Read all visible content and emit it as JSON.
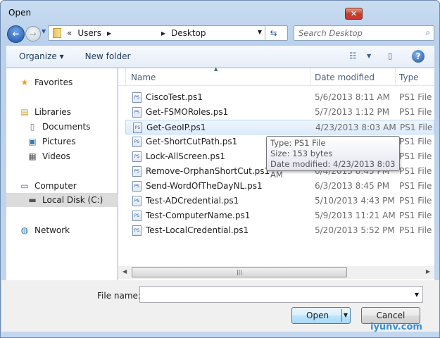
{
  "window": {
    "title": "Open",
    "close": "✕"
  },
  "address": {
    "path": [
      "«",
      "Users",
      "▸",
      "▸",
      "Desktop"
    ]
  },
  "search": {
    "placeholder": "Search Desktop"
  },
  "toolbar": {
    "organize": "Organize ▾",
    "new_folder": "New folder"
  },
  "nav": [
    {
      "label": "Favorites",
      "icon": "★"
    },
    {
      "label": "Libraries",
      "icon": "▤"
    },
    {
      "label": "Documents",
      "icon": "▯"
    },
    {
      "label": "Pictures",
      "icon": "▣"
    },
    {
      "label": "Videos",
      "icon": "▦"
    },
    {
      "label": "Computer",
      "icon": "▭"
    },
    {
      "label": "Local Disk (C:)",
      "icon": "▬"
    },
    {
      "label": "Network",
      "icon": "◍"
    }
  ],
  "columns": {
    "name": "Name",
    "date": "Date modified",
    "type": "Type"
  },
  "files": [
    {
      "name": "CiscoTest.ps1",
      "date": "5/6/2013 8:11 AM",
      "type": "PS1 File"
    },
    {
      "name": "Get-FSMORoles.ps1",
      "date": "5/7/2013 1:12 PM",
      "type": "PS1 File"
    },
    {
      "name": "Get-GeoIP.ps1",
      "date": "4/23/2013 8:03 AM",
      "type": "PS1 File"
    },
    {
      "name": "Get-ShortCutPath.ps1",
      "date": "",
      "type": "PS1 File"
    },
    {
      "name": "Lock-AllScreen.ps1",
      "date": "",
      "type": "PS1 File"
    },
    {
      "name": "Remove-OrphanShortCut.ps1",
      "date": "6/4/2013 8:45 PM",
      "type": "PS1 File"
    },
    {
      "name": "Send-WordOfTheDayNL.ps1",
      "date": "6/3/2013 8:45 PM",
      "type": "PS1 File"
    },
    {
      "name": "Test-ADCredential.ps1",
      "date": "5/10/2013 4:43 PM",
      "type": "PS1 File"
    },
    {
      "name": "Test-ComputerName.ps1",
      "date": "5/9/2013 11:21 AM",
      "type": "PS1 File"
    },
    {
      "name": "Test-LocalCredential.ps1",
      "date": "5/20/2013 5:52 PM",
      "type": "PS1 File"
    }
  ],
  "tooltip": {
    "type": "Type: PS1 File",
    "size": "Size: 153 bytes",
    "date": "Date modified: 4/23/2013 8:03 AM"
  },
  "filename": {
    "label": "File name:",
    "value": ""
  },
  "buttons": {
    "open": "Open",
    "cancel": "Cancel"
  },
  "watermark": "iyunv.com"
}
